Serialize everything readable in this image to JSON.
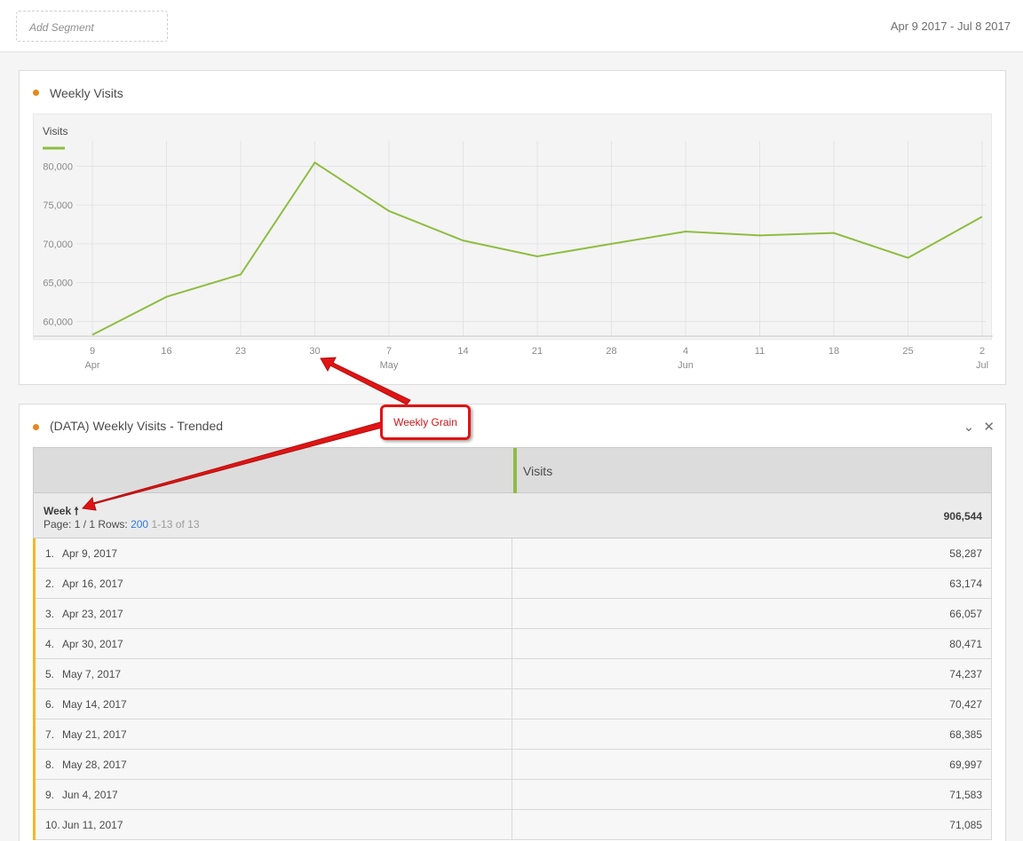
{
  "topbar": {
    "segment_placeholder": "Add Segment",
    "date_range": "Apr 9 2017 - Jul 8 2017"
  },
  "chart_panel": {
    "title": "Weekly Visits"
  },
  "table_panel": {
    "title": "(DATA) Weekly Visits - Trended",
    "metric": "Visits",
    "dimension": "Week",
    "page_label": "Page: 1 / 1",
    "rows_label": "Rows:",
    "rows_value": "200",
    "range_label": "1-13 of 13",
    "total": "906,544",
    "rows": [
      {
        "idx": "1.",
        "label": "Apr 9, 2017",
        "value": "58,287"
      },
      {
        "idx": "2.",
        "label": "Apr 16, 2017",
        "value": "63,174"
      },
      {
        "idx": "3.",
        "label": "Apr 23, 2017",
        "value": "66,057"
      },
      {
        "idx": "4.",
        "label": "Apr 30, 2017",
        "value": "80,471"
      },
      {
        "idx": "5.",
        "label": "May 7, 2017",
        "value": "74,237"
      },
      {
        "idx": "6.",
        "label": "May 14, 2017",
        "value": "70,427"
      },
      {
        "idx": "7.",
        "label": "May 21, 2017",
        "value": "68,385"
      },
      {
        "idx": "8.",
        "label": "May 28, 2017",
        "value": "69,997"
      },
      {
        "idx": "9.",
        "label": "Jun 4, 2017",
        "value": "71,583"
      },
      {
        "idx": "10.",
        "label": "Jun 11, 2017",
        "value": "71,085"
      }
    ]
  },
  "annotation": {
    "text": "Weekly Grain"
  },
  "colors": {
    "series": "#8fbd41",
    "accent_dot": "#e68619",
    "callout": "#e01414",
    "row_accent": "#f2b72c"
  },
  "chart_data": {
    "type": "line",
    "x": [
      "9",
      "16",
      "23",
      "30",
      "7",
      "14",
      "21",
      "28",
      "4",
      "11",
      "18",
      "25",
      "2"
    ],
    "x_months": [
      "Apr",
      "",
      "",
      "",
      "May",
      "",
      "",
      "",
      "Jun",
      "",
      "",
      "",
      "Jul"
    ],
    "series": [
      {
        "name": "Visits",
        "values": [
          58287,
          63174,
          66057,
          80471,
          74237,
          70427,
          68385,
          69997,
          71583,
          71085,
          71400,
          68200,
          73500
        ]
      }
    ],
    "yticks": [
      "60,000",
      "65,000",
      "70,000",
      "75,000",
      "80,000"
    ],
    "ylim": [
      58100,
      82100
    ],
    "legend": "top-left",
    "grid": true
  }
}
